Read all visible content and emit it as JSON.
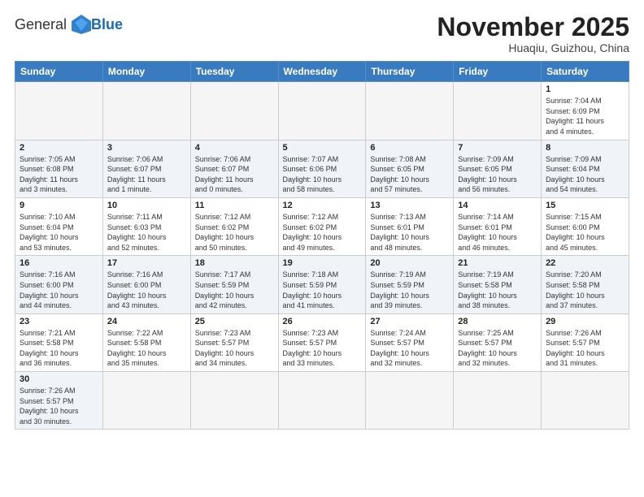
{
  "logo": {
    "text_normal": "General",
    "text_bold": "Blue"
  },
  "title": "November 2025",
  "location": "Huaqiu, Guizhou, China",
  "days_of_week": [
    "Sunday",
    "Monday",
    "Tuesday",
    "Wednesday",
    "Thursday",
    "Friday",
    "Saturday"
  ],
  "weeks": [
    [
      {
        "day": "",
        "info": ""
      },
      {
        "day": "",
        "info": ""
      },
      {
        "day": "",
        "info": ""
      },
      {
        "day": "",
        "info": ""
      },
      {
        "day": "",
        "info": ""
      },
      {
        "day": "",
        "info": ""
      },
      {
        "day": "1",
        "info": "Sunrise: 7:04 AM\nSunset: 6:09 PM\nDaylight: 11 hours\nand 4 minutes."
      }
    ],
    [
      {
        "day": "2",
        "info": "Sunrise: 7:05 AM\nSunset: 6:08 PM\nDaylight: 11 hours\nand 3 minutes."
      },
      {
        "day": "3",
        "info": "Sunrise: 7:06 AM\nSunset: 6:07 PM\nDaylight: 11 hours\nand 1 minute."
      },
      {
        "day": "4",
        "info": "Sunrise: 7:06 AM\nSunset: 6:07 PM\nDaylight: 11 hours\nand 0 minutes."
      },
      {
        "day": "5",
        "info": "Sunrise: 7:07 AM\nSunset: 6:06 PM\nDaylight: 10 hours\nand 58 minutes."
      },
      {
        "day": "6",
        "info": "Sunrise: 7:08 AM\nSunset: 6:05 PM\nDaylight: 10 hours\nand 57 minutes."
      },
      {
        "day": "7",
        "info": "Sunrise: 7:09 AM\nSunset: 6:05 PM\nDaylight: 10 hours\nand 56 minutes."
      },
      {
        "day": "8",
        "info": "Sunrise: 7:09 AM\nSunset: 6:04 PM\nDaylight: 10 hours\nand 54 minutes."
      }
    ],
    [
      {
        "day": "9",
        "info": "Sunrise: 7:10 AM\nSunset: 6:04 PM\nDaylight: 10 hours\nand 53 minutes."
      },
      {
        "day": "10",
        "info": "Sunrise: 7:11 AM\nSunset: 6:03 PM\nDaylight: 10 hours\nand 52 minutes."
      },
      {
        "day": "11",
        "info": "Sunrise: 7:12 AM\nSunset: 6:02 PM\nDaylight: 10 hours\nand 50 minutes."
      },
      {
        "day": "12",
        "info": "Sunrise: 7:12 AM\nSunset: 6:02 PM\nDaylight: 10 hours\nand 49 minutes."
      },
      {
        "day": "13",
        "info": "Sunrise: 7:13 AM\nSunset: 6:01 PM\nDaylight: 10 hours\nand 48 minutes."
      },
      {
        "day": "14",
        "info": "Sunrise: 7:14 AM\nSunset: 6:01 PM\nDaylight: 10 hours\nand 46 minutes."
      },
      {
        "day": "15",
        "info": "Sunrise: 7:15 AM\nSunset: 6:00 PM\nDaylight: 10 hours\nand 45 minutes."
      }
    ],
    [
      {
        "day": "16",
        "info": "Sunrise: 7:16 AM\nSunset: 6:00 PM\nDaylight: 10 hours\nand 44 minutes."
      },
      {
        "day": "17",
        "info": "Sunrise: 7:16 AM\nSunset: 6:00 PM\nDaylight: 10 hours\nand 43 minutes."
      },
      {
        "day": "18",
        "info": "Sunrise: 7:17 AM\nSunset: 5:59 PM\nDaylight: 10 hours\nand 42 minutes."
      },
      {
        "day": "19",
        "info": "Sunrise: 7:18 AM\nSunset: 5:59 PM\nDaylight: 10 hours\nand 41 minutes."
      },
      {
        "day": "20",
        "info": "Sunrise: 7:19 AM\nSunset: 5:59 PM\nDaylight: 10 hours\nand 39 minutes."
      },
      {
        "day": "21",
        "info": "Sunrise: 7:19 AM\nSunset: 5:58 PM\nDaylight: 10 hours\nand 38 minutes."
      },
      {
        "day": "22",
        "info": "Sunrise: 7:20 AM\nSunset: 5:58 PM\nDaylight: 10 hours\nand 37 minutes."
      }
    ],
    [
      {
        "day": "23",
        "info": "Sunrise: 7:21 AM\nSunset: 5:58 PM\nDaylight: 10 hours\nand 36 minutes."
      },
      {
        "day": "24",
        "info": "Sunrise: 7:22 AM\nSunset: 5:58 PM\nDaylight: 10 hours\nand 35 minutes."
      },
      {
        "day": "25",
        "info": "Sunrise: 7:23 AM\nSunset: 5:57 PM\nDaylight: 10 hours\nand 34 minutes."
      },
      {
        "day": "26",
        "info": "Sunrise: 7:23 AM\nSunset: 5:57 PM\nDaylight: 10 hours\nand 33 minutes."
      },
      {
        "day": "27",
        "info": "Sunrise: 7:24 AM\nSunset: 5:57 PM\nDaylight: 10 hours\nand 32 minutes."
      },
      {
        "day": "28",
        "info": "Sunrise: 7:25 AM\nSunset: 5:57 PM\nDaylight: 10 hours\nand 32 minutes."
      },
      {
        "day": "29",
        "info": "Sunrise: 7:26 AM\nSunset: 5:57 PM\nDaylight: 10 hours\nand 31 minutes."
      }
    ],
    [
      {
        "day": "30",
        "info": "Sunrise: 7:26 AM\nSunset: 5:57 PM\nDaylight: 10 hours\nand 30 minutes."
      },
      {
        "day": "",
        "info": ""
      },
      {
        "day": "",
        "info": ""
      },
      {
        "day": "",
        "info": ""
      },
      {
        "day": "",
        "info": ""
      },
      {
        "day": "",
        "info": ""
      },
      {
        "day": "",
        "info": ""
      }
    ]
  ]
}
